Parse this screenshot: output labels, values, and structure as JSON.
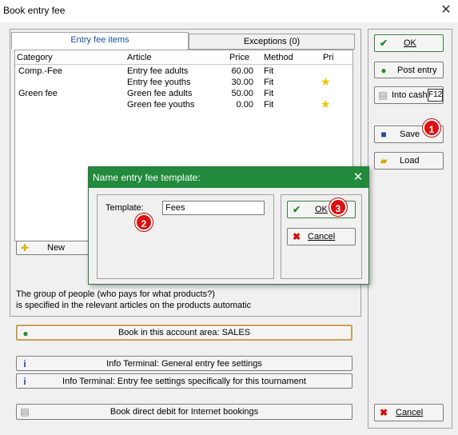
{
  "window": {
    "title": "Book entry fee",
    "close_glyph": "✕"
  },
  "tabs": [
    {
      "label": "Entry fee items",
      "active": true
    },
    {
      "label": "Exceptions (0)",
      "active": false
    }
  ],
  "table": {
    "headers": [
      "Category",
      "Article",
      "Price",
      "Method",
      "Pri"
    ],
    "rows": [
      {
        "category": "Comp.-Fee",
        "article": "Entry fee adults",
        "price": "60.00",
        "method": "Fit",
        "pri": false
      },
      {
        "category": "",
        "article": "Entry fee youths",
        "price": "30.00",
        "method": "Fit",
        "pri": true
      },
      {
        "category": "Green fee",
        "article": "Green fee adults",
        "price": "50.00",
        "method": "Fit",
        "pri": false
      },
      {
        "category": "",
        "article": "Green fee youths",
        "price": "0.00",
        "method": "Fit",
        "pri": true
      }
    ],
    "star_glyph": "★"
  },
  "new_button": {
    "label": "New",
    "icon": "plus-icon"
  },
  "info_text": [
    "The group of people (who pays for what products?)",
    "is specified in the relevant articles on the products automatic"
  ],
  "bottom_buttons": {
    "book_account": "Book in this account area: SALES",
    "info_general": "Info Terminal: General entry fee settings",
    "info_tournament": "Info Terminal: Entry fee settings specifically for this tournament",
    "direct_debit": "Book direct debit for Internet bookings"
  },
  "right_buttons": {
    "ok": "OK",
    "post_entry": "Post entry",
    "into_cash": "Into cash",
    "into_cash_key": "F12",
    "save": "Save",
    "load": "Load",
    "cancel": "Cancel"
  },
  "modal": {
    "title": "Name entry fee template:",
    "close_glyph": "✕",
    "template_label": "Template:",
    "template_value": "Fees",
    "ok": "OK",
    "cancel": "Cancel"
  },
  "badges": [
    "1",
    "2",
    "3"
  ],
  "glyphs": {
    "check": "✔",
    "cross": "✖",
    "plus": "✚"
  },
  "colors": {
    "modal_title_bg": "#218a3c",
    "badge_red": "#e01010",
    "accent_blue": "#1a4fa0"
  }
}
